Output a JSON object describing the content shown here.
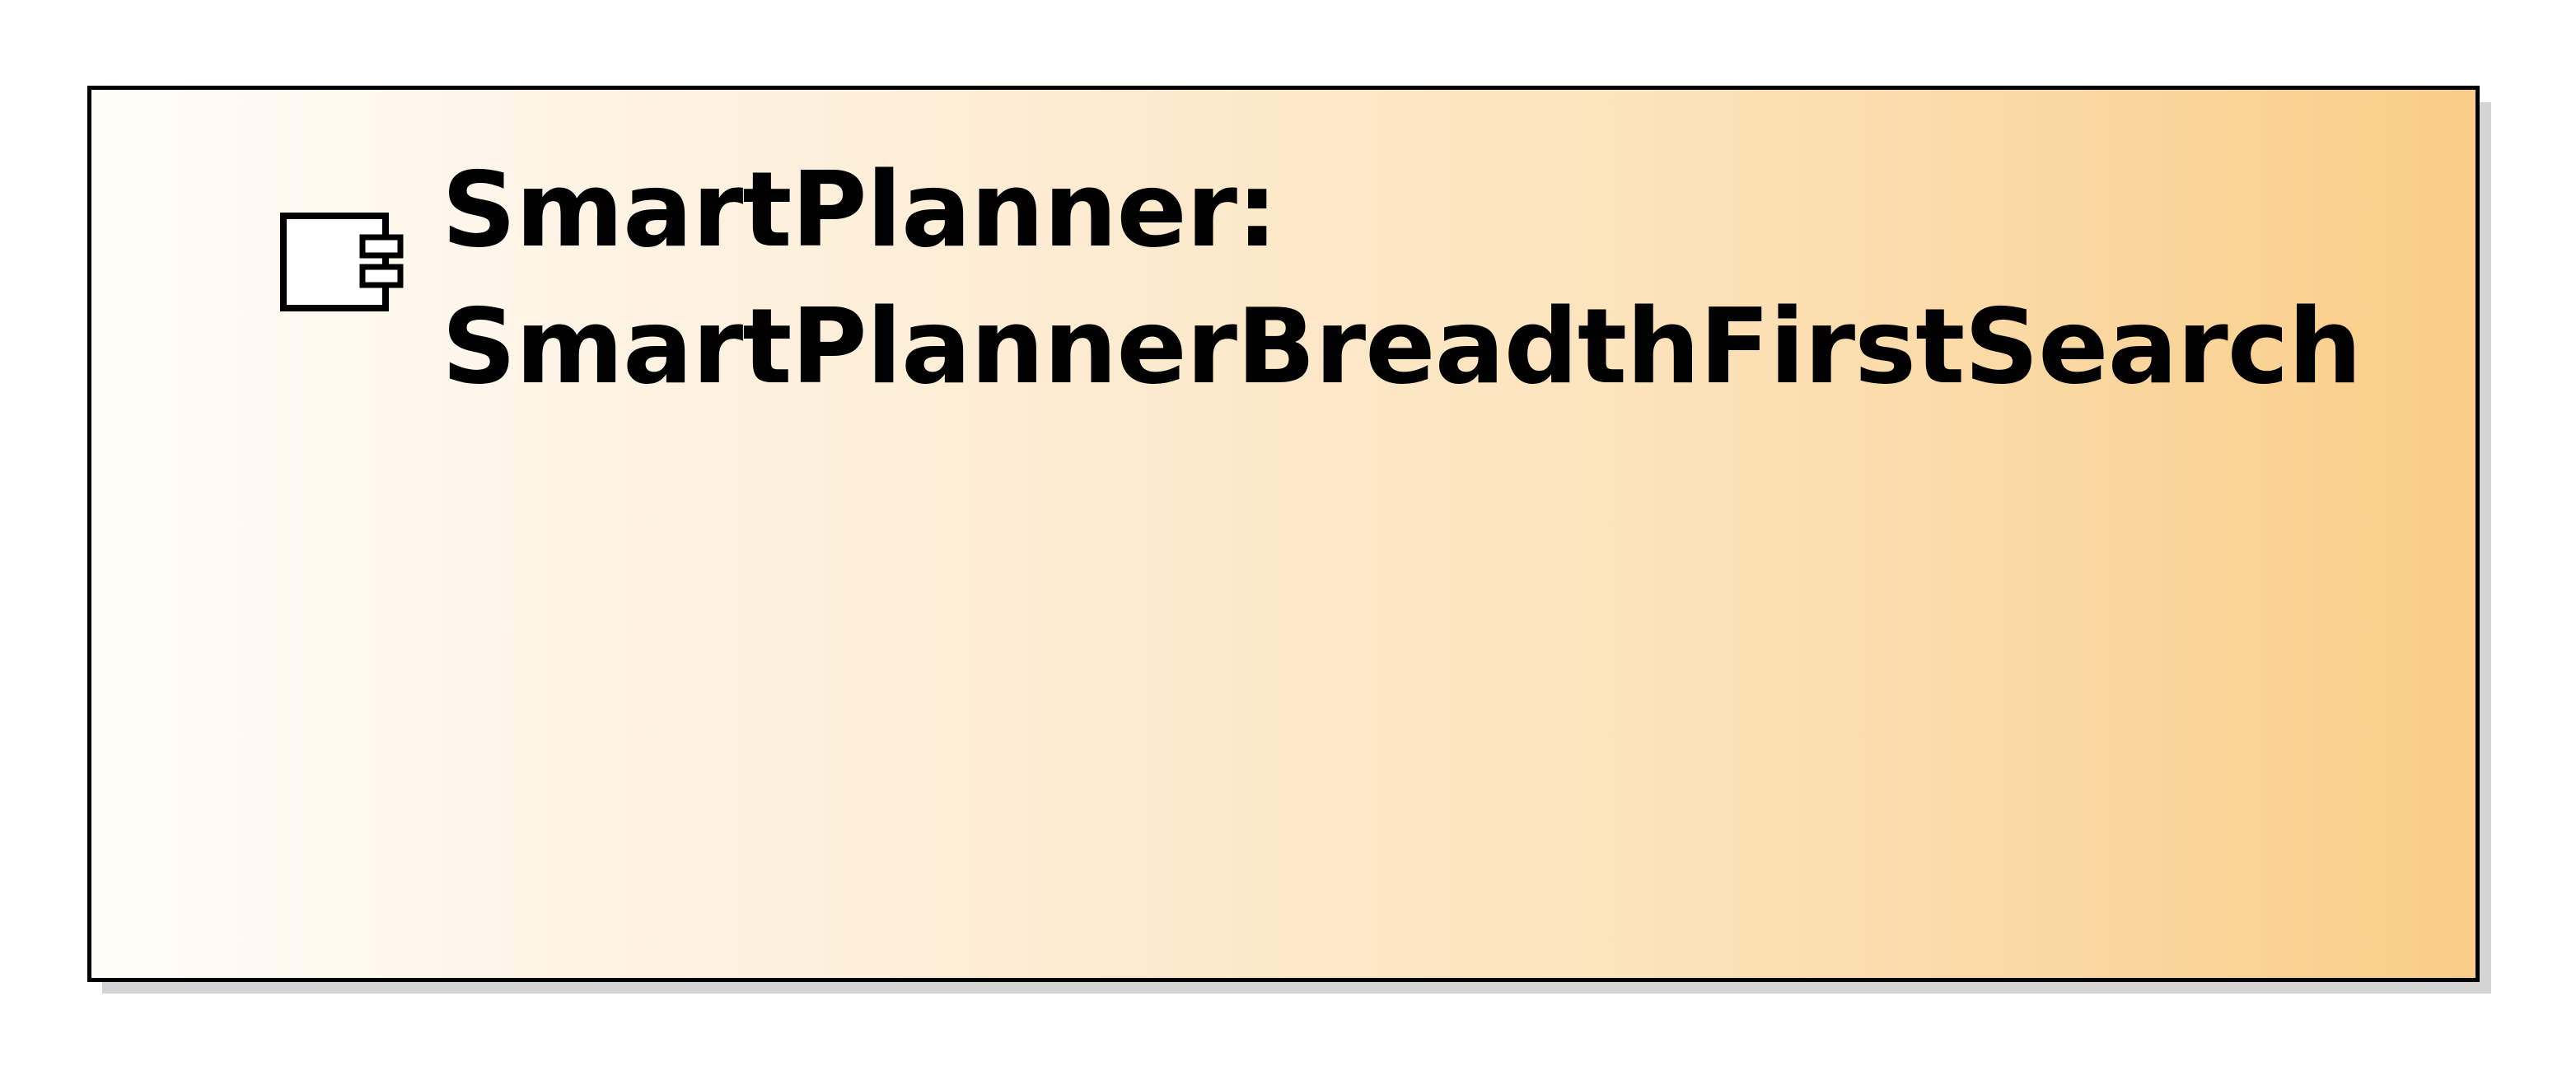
{
  "component": {
    "title_line1": "SmartPlanner:",
    "title_line2": "SmartPlannerBreadthFirstSearch",
    "icon": "component-icon",
    "colors": {
      "border": "#000000",
      "gradient_start": "#fffdf8",
      "gradient_end": "#f9cd88",
      "shadow": "#d4d4d4"
    }
  }
}
